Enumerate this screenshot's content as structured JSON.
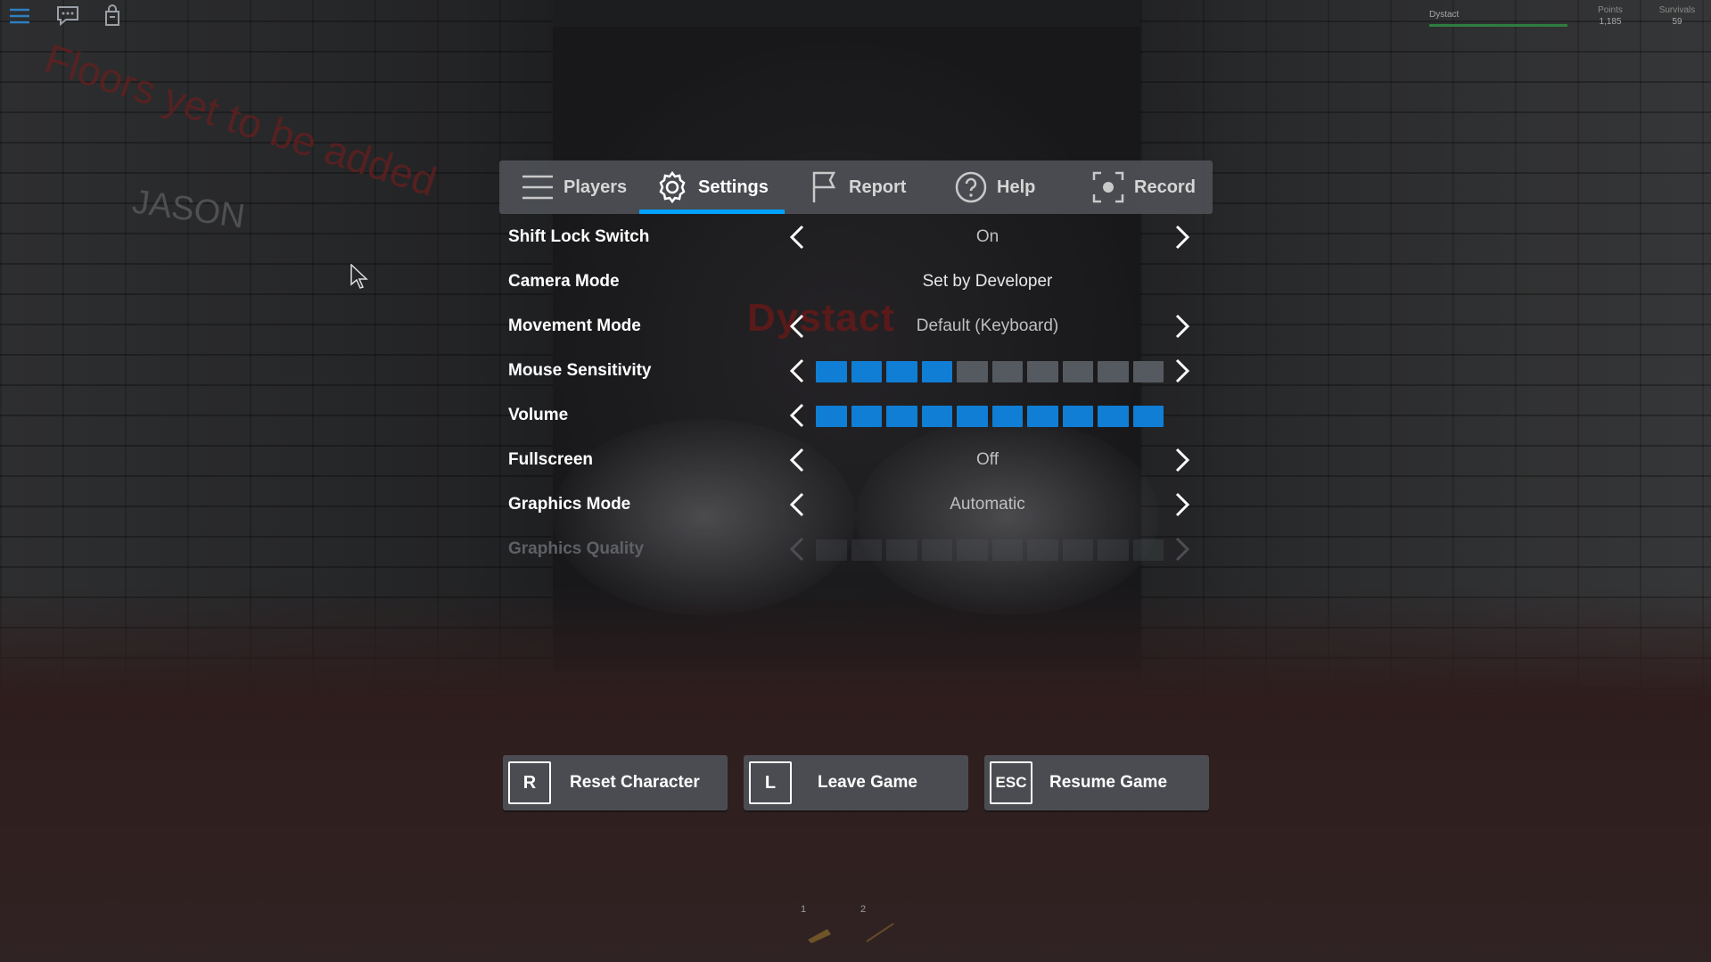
{
  "scene": {
    "wall_text_red": "Floors yet to be added",
    "wall_text_name": "JASON",
    "sign_text": "Dystact"
  },
  "topbar": {
    "icons": [
      "menu-icon",
      "chat-icon",
      "backpack-icon"
    ]
  },
  "leaderboard": {
    "player_name": "Dystact",
    "stats": [
      {
        "label": "Points",
        "value": "1,185"
      },
      {
        "label": "Survivals",
        "value": "59"
      }
    ]
  },
  "tabs": [
    {
      "label": "Players",
      "icon": "hamburger-icon",
      "active": false
    },
    {
      "label": "Settings",
      "icon": "gear-icon",
      "active": true
    },
    {
      "label": "Report",
      "icon": "flag-icon",
      "active": false
    },
    {
      "label": "Help",
      "icon": "question-icon",
      "active": false
    },
    {
      "label": "Record",
      "icon": "record-icon",
      "active": false
    }
  ],
  "settings": {
    "shift_lock": {
      "label": "Shift Lock Switch",
      "value": "On"
    },
    "camera_mode": {
      "label": "Camera Mode",
      "value": "Set by Developer"
    },
    "movement_mode": {
      "label": "Movement Mode",
      "value": "Default (Keyboard)"
    },
    "mouse_sensitivity": {
      "label": "Mouse Sensitivity",
      "level": 4,
      "max": 10
    },
    "volume": {
      "label": "Volume",
      "level": 10,
      "max": 10
    },
    "fullscreen": {
      "label": "Fullscreen",
      "value": "Off"
    },
    "graphics_mode": {
      "label": "Graphics Mode",
      "value": "Automatic"
    },
    "graphics_quality": {
      "label": "Graphics Quality",
      "disabled": true
    }
  },
  "buttons": {
    "reset": {
      "key": "R",
      "label": "Reset Character"
    },
    "leave": {
      "key": "L",
      "label": "Leave Game"
    },
    "resume": {
      "key": "ESC",
      "label": "Resume Game"
    }
  },
  "hotbar": {
    "slots": [
      "1",
      "2"
    ]
  },
  "colors": {
    "accent": "#00a2ff",
    "slider_on": "#0f7ed4",
    "slider_off": "#555a61"
  }
}
